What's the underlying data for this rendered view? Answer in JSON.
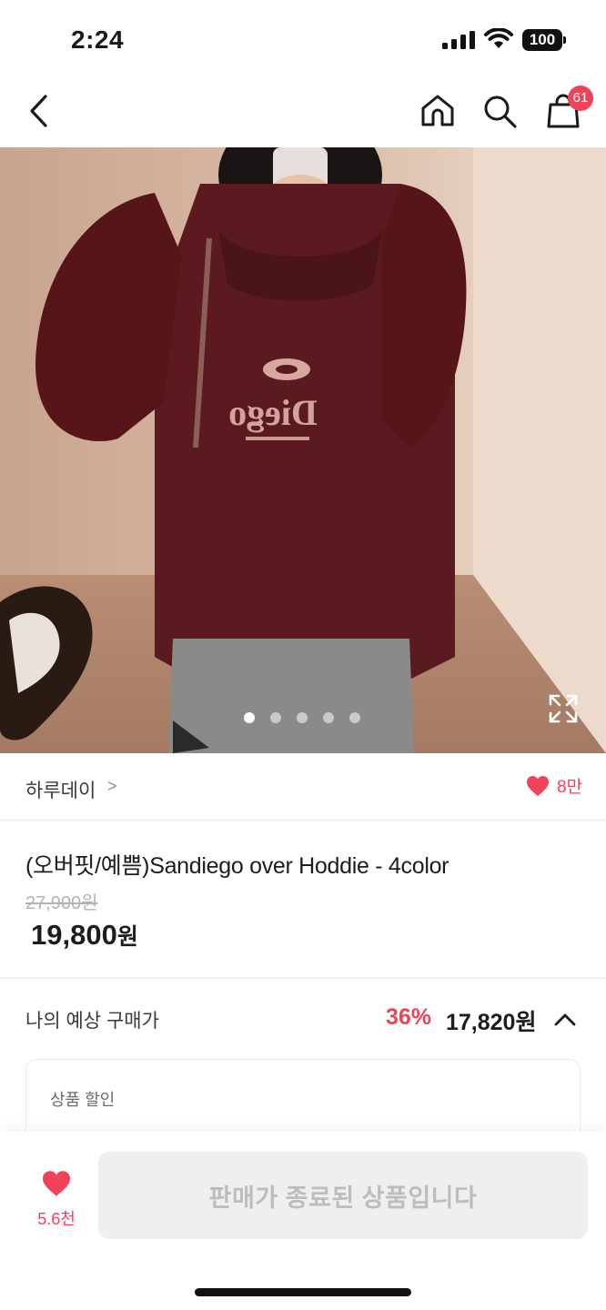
{
  "status": {
    "time": "2:24",
    "battery": "100"
  },
  "nav": {
    "cart_badge": "61"
  },
  "gallery": {
    "slide_count": 5,
    "active_index": 0,
    "print_text": "Diego"
  },
  "store": {
    "name": "하루데이",
    "chevron": ">",
    "like_count": "8만"
  },
  "product": {
    "title": "(오버핏/예쁨)Sandiego over Hoddie - 4color",
    "original_price": "27,900원",
    "sale_price_value": "19,800",
    "sale_price_unit": "원"
  },
  "expected": {
    "label": "나의 예상 구매가",
    "discount": "36%",
    "price": "17,820원"
  },
  "discount_card": {
    "label": "상품 할인"
  },
  "bottom": {
    "wish_count": "5.6천",
    "soldout_label": "판매가 종료된 상품입니다"
  },
  "colors": {
    "accent": "#f0435a",
    "hoodie": "#5a1a1f",
    "disabled_bg": "#efefef"
  }
}
